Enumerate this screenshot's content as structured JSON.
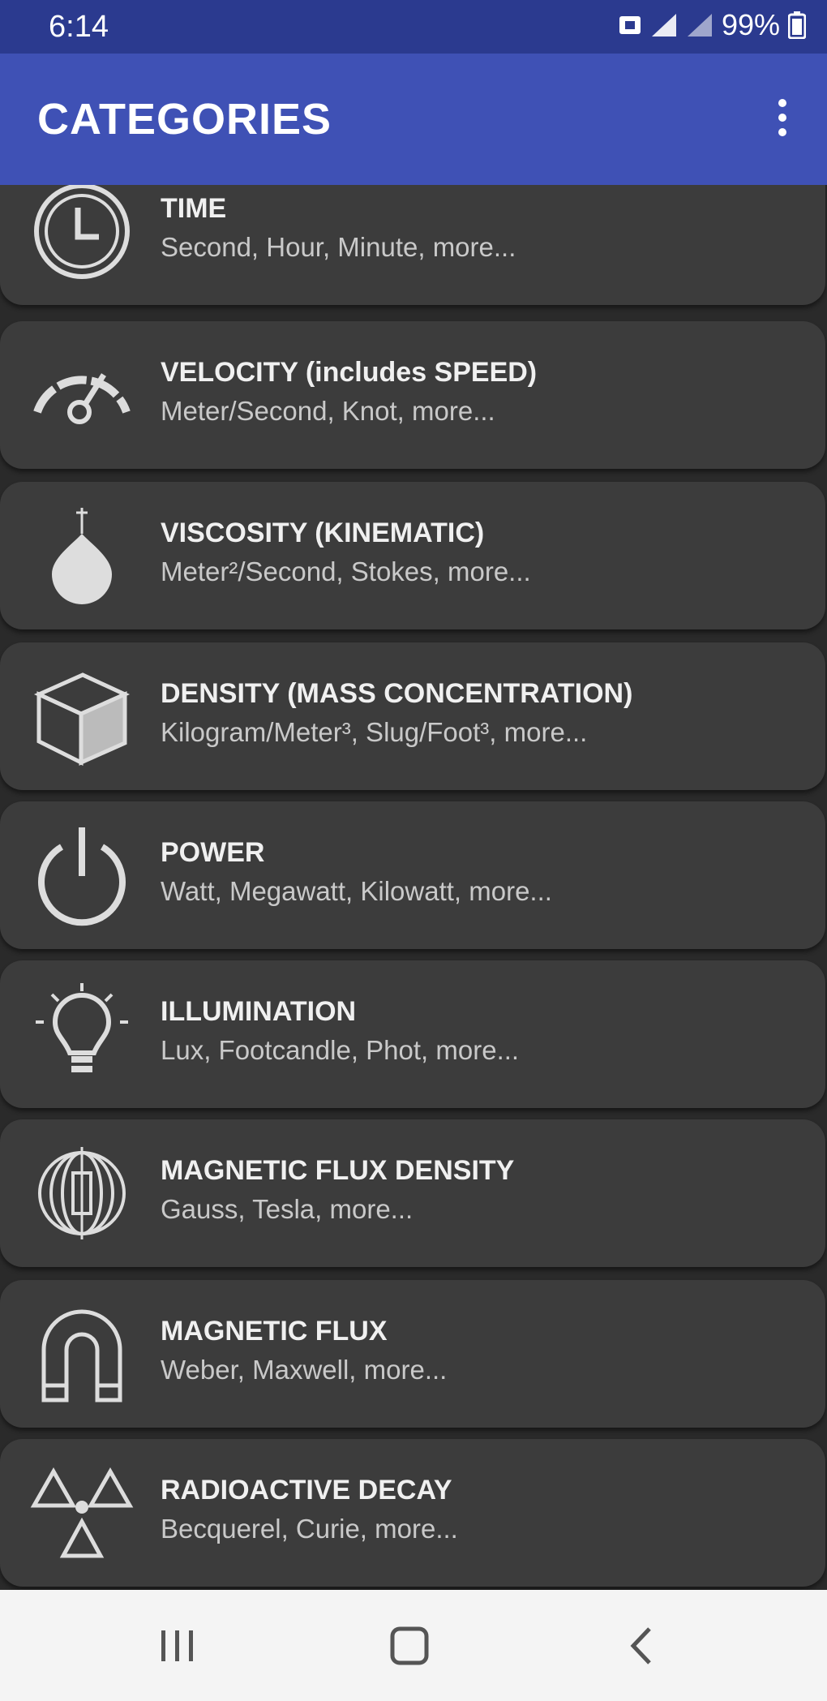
{
  "status_bar": {
    "time": "6:14",
    "battery": "99%"
  },
  "app_bar": {
    "title": "CATEGORIES",
    "menu_icon": "overflow-menu-icon"
  },
  "categories": [
    {
      "title": "TIME",
      "subtitle": "Second, Hour, Minute, more...",
      "icon": "clock-icon"
    },
    {
      "title": "VELOCITY (includes SPEED)",
      "subtitle": "Meter/Second, Knot, more...",
      "icon": "speedometer-icon"
    },
    {
      "title": "VISCOSITY (KINEMATIC)",
      "subtitle": "Meter²/Second, Stokes, more...",
      "icon": "droplet-icon"
    },
    {
      "title": "DENSITY (MASS CONCENTRATION)",
      "subtitle": "Kilogram/Meter³, Slug/Foot³, more...",
      "icon": "cube-icon"
    },
    {
      "title": "POWER",
      "subtitle": "Watt, Megawatt, Kilowatt, more...",
      "icon": "power-icon"
    },
    {
      "title": "ILLUMINATION",
      "subtitle": "Lux, Footcandle, Phot, more...",
      "icon": "lightbulb-icon"
    },
    {
      "title": "MAGNETIC FLUX DENSITY",
      "subtitle": "Gauss, Tesla, more...",
      "icon": "coil-icon"
    },
    {
      "title": "MAGNETIC FLUX",
      "subtitle": "Weber, Maxwell, more...",
      "icon": "magnet-icon"
    },
    {
      "title": "RADIOACTIVE DECAY",
      "subtitle": "Becquerel, Curie, more...",
      "icon": "radiation-icon"
    }
  ],
  "nav_bar": {
    "recents_icon": "recents-icon",
    "home_icon": "home-icon",
    "back_icon": "back-icon"
  }
}
